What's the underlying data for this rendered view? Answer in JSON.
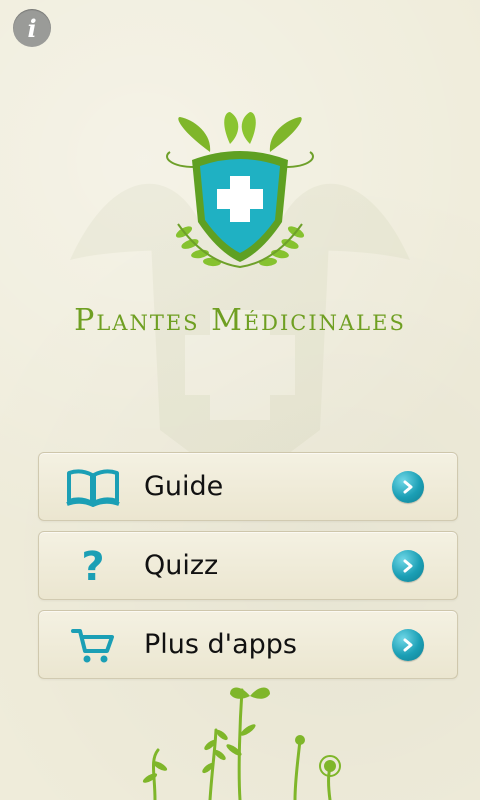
{
  "app": {
    "title": "Plantes Médicinales",
    "info_icon": "info-icon",
    "accent_color": "#6f9f22",
    "icon_color": "#1b9fb5"
  },
  "menu": {
    "items": [
      {
        "label": "Guide",
        "icon": "book-icon"
      },
      {
        "label": "Quizz",
        "icon": "question-icon"
      },
      {
        "label": "Plus d'apps",
        "icon": "cart-icon"
      }
    ],
    "arrow_icon": "chevron-right-icon"
  }
}
